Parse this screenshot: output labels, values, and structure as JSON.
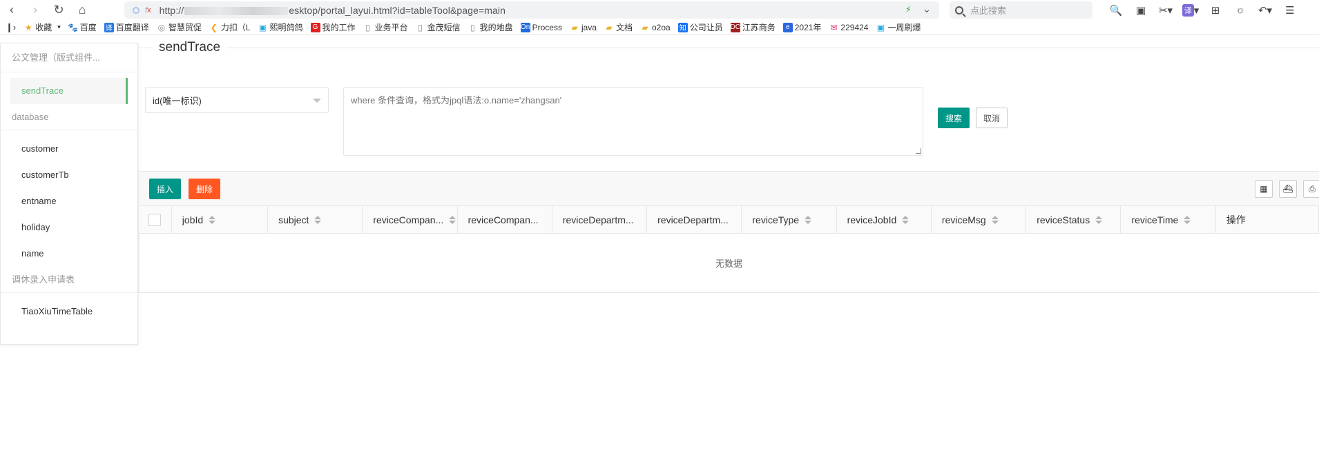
{
  "browser": {
    "url_prefix": "http://",
    "url_suffix": "esktop/portal_layui.html?id=tableTool&page=main",
    "fx_label": "f",
    "fx_x": "x",
    "search_placeholder": "点此搜索",
    "translate_label": "译"
  },
  "bookmarks": [
    {
      "label": "收藏",
      "icon": "star",
      "color": "#f5a623"
    },
    {
      "label": "百度",
      "icon": "paw",
      "color": "#2a66e0"
    },
    {
      "label": "百度翻译",
      "icon": "译",
      "color": "#2a7ae2"
    },
    {
      "label": "智慧贸促",
      "icon": "globe",
      "color": "#888"
    },
    {
      "label": "力扣（L",
      "icon": "leet",
      "color": "#f89f1b"
    },
    {
      "label": "熙明鸽鸽",
      "icon": "bili",
      "color": "#23ade5"
    },
    {
      "label": "我的工作",
      "icon": "G",
      "color": "#e02020"
    },
    {
      "label": "业务平台",
      "icon": "doc",
      "color": "#888"
    },
    {
      "label": "金茂短信",
      "icon": "doc",
      "color": "#888"
    },
    {
      "label": "我的地盘",
      "icon": "doc",
      "color": "#888"
    },
    {
      "label": "Process",
      "icon": "On",
      "color": "#1e6be0"
    },
    {
      "label": "java",
      "icon": "folder",
      "color": "#e6b430"
    },
    {
      "label": "文档",
      "icon": "folder",
      "color": "#e6b430"
    },
    {
      "label": "o2oa",
      "icon": "folder",
      "color": "#e6b430"
    },
    {
      "label": "公司让员",
      "icon": "知",
      "color": "#1772f6"
    },
    {
      "label": "江苏商务",
      "icon": "DC",
      "color": "#a02020"
    },
    {
      "label": "2021年",
      "icon": "e",
      "color": "#2a66e0"
    },
    {
      "label": "229424",
      "icon": "mail",
      "color": "#e0306a"
    },
    {
      "label": "一周刷爆",
      "icon": "bili",
      "color": "#23ade5"
    }
  ],
  "sidebar": {
    "groups": [
      {
        "title": "公文管理（版式组件...",
        "items": [
          {
            "label": "sendTrace",
            "active": true
          }
        ]
      },
      {
        "title": "database",
        "items": [
          {
            "label": "customer"
          },
          {
            "label": "customerTb"
          },
          {
            "label": "entname"
          },
          {
            "label": "holiday"
          },
          {
            "label": "name"
          }
        ]
      },
      {
        "title": "调休录入申请表",
        "items": [
          {
            "label": "TiaoXiuTimeTable"
          }
        ]
      }
    ]
  },
  "main": {
    "legend": "sendTrace",
    "select_value": "id(唯一标识)",
    "where_placeholder": "where 条件查询，格式为jpql语法:o.name='zhangsan'",
    "search_label": "搜索",
    "cancel_label": "取消",
    "insert_label": "插入",
    "delete_label": "删除",
    "columns": [
      {
        "label": "jobId",
        "width": 140
      },
      {
        "label": "subject",
        "width": 138
      },
      {
        "label": "reviceCompan...",
        "width": 138
      },
      {
        "label": "reviceCompan...",
        "width": 138,
        "nosort": true
      },
      {
        "label": "reviceDepartm...",
        "width": 138,
        "nosort": true
      },
      {
        "label": "reviceDepartm...",
        "width": 138,
        "nosort": true
      },
      {
        "label": "reviceType",
        "width": 138
      },
      {
        "label": "reviceJobId",
        "width": 138
      },
      {
        "label": "reviceMsg",
        "width": 138
      },
      {
        "label": "reviceStatus",
        "width": 138
      },
      {
        "label": "reviceTime",
        "width": 138
      },
      {
        "label": "操作",
        "width": 150,
        "nosort": true
      }
    ],
    "empty_text": "无数据"
  },
  "colors": {
    "primary": "#009688",
    "danger": "#ff5722",
    "active": "#5fb878"
  }
}
